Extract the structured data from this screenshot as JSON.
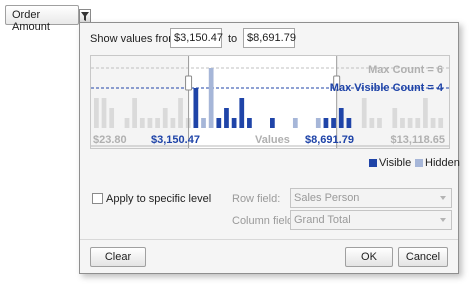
{
  "header": {
    "field_label": "Order Amount"
  },
  "range": {
    "label_from": "Show values from",
    "from_value": "$3,150.47",
    "label_to": "to",
    "to_value": "$8,691.79"
  },
  "chart": {
    "max_count_label": "Max Count = 6",
    "max_visible_label": "Max Visible Count = 4",
    "axis_min": "$23.80",
    "axis_from": "$3,150.47",
    "axis_title": "Values",
    "axis_to": "$8,691.79",
    "axis_max": "$13,118.65",
    "legend_visible": "Visible",
    "legend_hidden": "Hidden",
    "colors": {
      "visible": "#1f44a8",
      "hidden": "#a6b6d8",
      "outside": "#dadada"
    }
  },
  "chart_data": {
    "type": "bar",
    "bars": [
      {
        "count": 3,
        "state": "outside"
      },
      {
        "count": 3,
        "state": "outside"
      },
      {
        "count": 2,
        "state": "outside"
      },
      {
        "count": 0,
        "state": "outside"
      },
      {
        "count": 1,
        "state": "outside"
      },
      {
        "count": 3,
        "state": "outside"
      },
      {
        "count": 1,
        "state": "outside"
      },
      {
        "count": 1,
        "state": "outside"
      },
      {
        "count": 1,
        "state": "outside"
      },
      {
        "count": 2,
        "state": "outside"
      },
      {
        "count": 1,
        "state": "outside"
      },
      {
        "count": 3,
        "state": "outside"
      },
      {
        "count": 1,
        "state": "outside"
      },
      {
        "count": 4,
        "state": "visible"
      },
      {
        "count": 1,
        "state": "hidden"
      },
      {
        "count": 6,
        "state": "hidden"
      },
      {
        "count": 1,
        "state": "visible"
      },
      {
        "count": 2,
        "state": "visible"
      },
      {
        "count": 1,
        "state": "visible"
      },
      {
        "count": 3,
        "state": "visible"
      },
      {
        "count": 1,
        "state": "visible"
      },
      {
        "count": 0,
        "state": "visible"
      },
      {
        "count": 0,
        "state": "visible"
      },
      {
        "count": 1,
        "state": "visible"
      },
      {
        "count": 0,
        "state": "visible"
      },
      {
        "count": 0,
        "state": "visible"
      },
      {
        "count": 1,
        "state": "hidden"
      },
      {
        "count": 0,
        "state": "visible"
      },
      {
        "count": 0,
        "state": "visible"
      },
      {
        "count": 1,
        "state": "hidden"
      },
      {
        "count": 1,
        "state": "visible"
      },
      {
        "count": 1,
        "state": "visible"
      },
      {
        "count": 2,
        "state": "visible"
      },
      {
        "count": 1,
        "state": "visible"
      },
      {
        "count": 0,
        "state": "visible"
      },
      {
        "count": 3,
        "state": "outside"
      },
      {
        "count": 1,
        "state": "outside"
      },
      {
        "count": 1,
        "state": "outside"
      },
      {
        "count": 0,
        "state": "outside"
      },
      {
        "count": 2,
        "state": "outside"
      },
      {
        "count": 1,
        "state": "outside"
      },
      {
        "count": 1,
        "state": "outside"
      },
      {
        "count": 1,
        "state": "outside"
      },
      {
        "count": 3,
        "state": "outside"
      },
      {
        "count": 1,
        "state": "outside"
      },
      {
        "count": 1,
        "state": "outside"
      }
    ],
    "max_count": 6,
    "max_visible_count": 4,
    "x_range": [
      23.8,
      13118.65
    ],
    "selected_range": [
      3150.47,
      8691.79
    ]
  },
  "level": {
    "checkbox_label": "Apply to specific level",
    "checked": false,
    "row_field_label": "Row field:",
    "row_field_value": "Sales Person",
    "column_field_label": "Column field:",
    "column_field_value": "Grand Total"
  },
  "buttons": {
    "clear": "Clear",
    "ok": "OK",
    "cancel": "Cancel"
  }
}
